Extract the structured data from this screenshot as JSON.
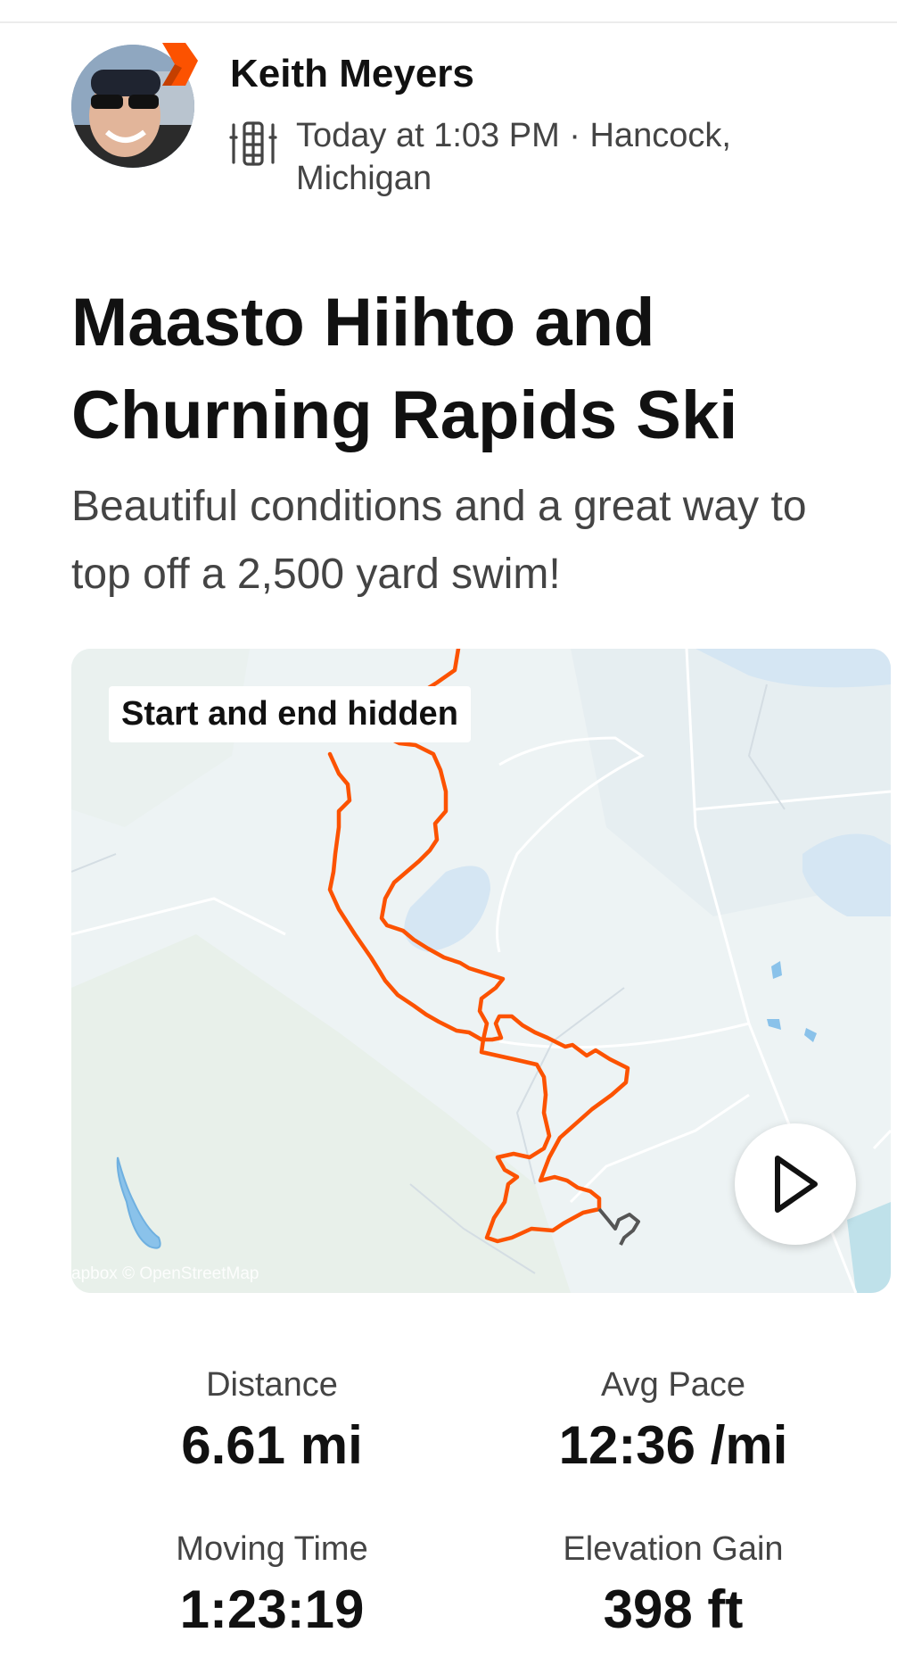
{
  "athlete": {
    "name": "Keith Meyers",
    "meta": "Today at 1:03 PM · Hancock, Michigan",
    "sport_icon": "nordic-ski-icon"
  },
  "activity": {
    "title": "Maasto Hiihto and Churning Rapids Ski",
    "description": "Beautiful conditions and a great way to top off a 2,500 yard swim!"
  },
  "map": {
    "privacy_label": "Start and end hidden",
    "attribution": "apbox © OpenStreetMap",
    "route_color": "#fc5200",
    "hidden_segment_color": "#555555",
    "water_color": "#cfe3f3",
    "play_icon": "play-icon"
  },
  "stats": [
    {
      "label": "Distance",
      "value": "6.61 mi"
    },
    {
      "label": "Avg Pace",
      "value": "12:36 /mi"
    },
    {
      "label": "Moving Time",
      "value": "1:23:19"
    },
    {
      "label": "Elevation Gain",
      "value": "398 ft"
    }
  ],
  "colors": {
    "brand": "#fc5200",
    "text": "#111111",
    "muted": "#444444"
  }
}
